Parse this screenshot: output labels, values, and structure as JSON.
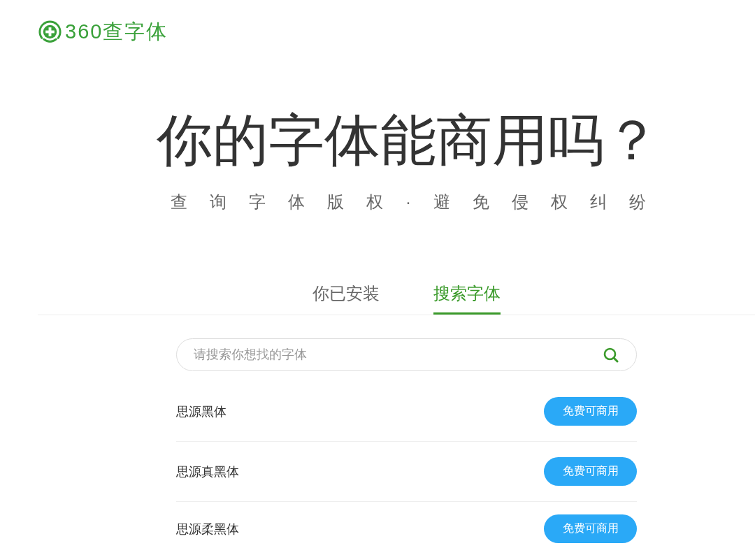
{
  "logo": {
    "text": "360查字体"
  },
  "hero": {
    "title": "你的字体能商用吗？",
    "subtitle": "查询字体版权·避免侵权纠纷"
  },
  "tabs": [
    {
      "label": "你已安装",
      "selected": false
    },
    {
      "label": "搜索字体",
      "selected": true
    }
  ],
  "search": {
    "placeholder": "请搜索你想找的字体"
  },
  "fonts": [
    {
      "name": "思源黑体",
      "license": "免费可商用"
    },
    {
      "name": "思源真黑体",
      "license": "免费可商用"
    },
    {
      "name": "思源柔黑体",
      "license": "免费可商用"
    }
  ]
}
